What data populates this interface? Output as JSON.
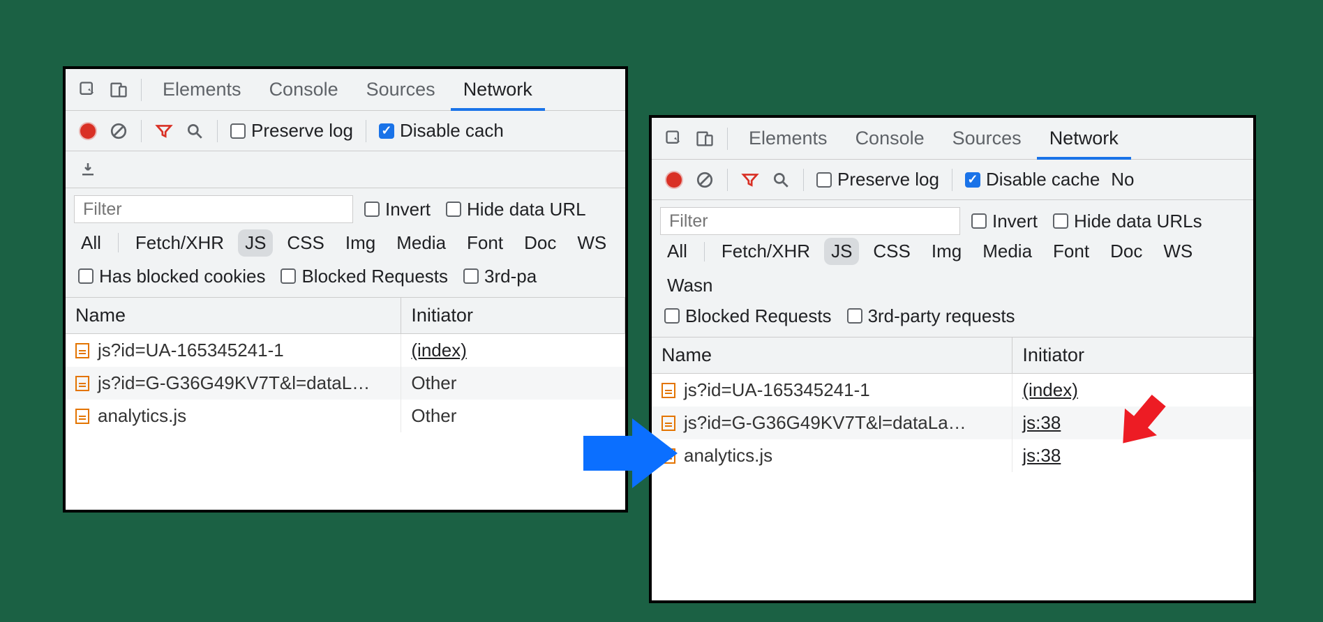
{
  "tabs": {
    "elements": "Elements",
    "console": "Console",
    "sources": "Sources",
    "network": "Network"
  },
  "toolbar": {
    "preserve_log": "Preserve log",
    "disable_cache": "Disable cache",
    "disable_cache_cut_left": "Disable cach",
    "no_cut": "No"
  },
  "filter": {
    "placeholder": "Filter",
    "invert": "Invert",
    "hide_data_urls": "Hide data URLs",
    "hide_data_urls_cut": "Hide data URL"
  },
  "types": {
    "all": "All",
    "fetch": "Fetch/XHR",
    "js": "JS",
    "css": "CSS",
    "img": "Img",
    "media": "Media",
    "font": "Font",
    "doc": "Doc",
    "ws": "WS",
    "wasm_cut": "Wasn"
  },
  "extra_filters": {
    "has_blocked_cookies": "Has blocked cookies",
    "blocked_requests": "Blocked Requests",
    "third_party": "3rd-party requests",
    "third_party_cut": "3rd-pa"
  },
  "columns": {
    "name": "Name",
    "initiator": "Initiator"
  },
  "left_rows": [
    {
      "name": "js?id=UA-165345241-1",
      "initiator": "(index)",
      "link": true
    },
    {
      "name": "js?id=G-G36G49KV7T&l=dataL…",
      "initiator": "Other",
      "link": false
    },
    {
      "name": "analytics.js",
      "initiator": "Other",
      "link": false
    }
  ],
  "right_rows": [
    {
      "name": "js?id=UA-165345241-1",
      "initiator": "(index)",
      "link": true
    },
    {
      "name": "js?id=G-G36G49KV7T&l=dataLa…",
      "initiator": "js:38",
      "link": true
    },
    {
      "name": "analytics.js",
      "initiator": "js:38",
      "link": true
    }
  ]
}
